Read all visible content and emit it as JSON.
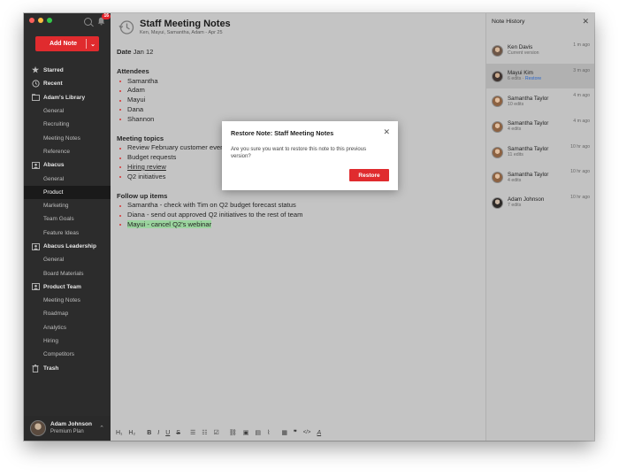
{
  "sidebar": {
    "notification_count": "16",
    "add_note_label": "Add Note",
    "items": [
      {
        "label": "Starred",
        "icon": "star-icon",
        "level": "top"
      },
      {
        "label": "Recent",
        "icon": "clock-icon",
        "level": "top"
      },
      {
        "label": "Adam's Library",
        "icon": "folder-icon",
        "level": "top"
      },
      {
        "label": "General",
        "level": "sub"
      },
      {
        "label": "Recruiting",
        "level": "sub"
      },
      {
        "label": "Meeting Notes",
        "level": "sub"
      },
      {
        "label": "Reference",
        "level": "sub"
      },
      {
        "label": "Abacus",
        "icon": "team-icon",
        "level": "top"
      },
      {
        "label": "General",
        "level": "sub"
      },
      {
        "label": "Product",
        "level": "sub",
        "active": true
      },
      {
        "label": "Marketing",
        "level": "sub"
      },
      {
        "label": "Team Goals",
        "level": "sub"
      },
      {
        "label": "Feature Ideas",
        "level": "sub"
      },
      {
        "label": "Abacus Leadership",
        "icon": "team-icon",
        "level": "top"
      },
      {
        "label": "General",
        "level": "sub"
      },
      {
        "label": "Board Materials",
        "level": "sub"
      },
      {
        "label": "Product Team",
        "icon": "team-icon",
        "level": "top"
      },
      {
        "label": "Meeting Notes",
        "level": "sub"
      },
      {
        "label": "Roadmap",
        "level": "sub"
      },
      {
        "label": "Analytics",
        "level": "sub"
      },
      {
        "label": "Hiring",
        "level": "sub"
      },
      {
        "label": "Competitors",
        "level": "sub"
      },
      {
        "label": "Trash",
        "icon": "trash-icon",
        "level": "top"
      }
    ],
    "user": {
      "name": "Adam Johnson",
      "plan": "Premium Plan"
    }
  },
  "note": {
    "title": "Staff Meeting Notes",
    "meta": "Ken, Mayui, Samantha, Adam - Apr 25",
    "date_label": "Date",
    "date_value": "Jan 12",
    "attendees_heading": "Attendees",
    "attendees": [
      "Samantha",
      "Adam",
      "Mayui",
      "Dana",
      "Shannon"
    ],
    "topics_heading": "Meeting topics",
    "topics": [
      "Review February customer events",
      "Budget requests",
      "Hiring review",
      "Q2 initiatives"
    ],
    "followup_heading": "Follow up items",
    "followups": [
      "Samantha - check with Tim on Q2 budget forecast status",
      "Diana - send out approved Q2 initiatives to the rest of team",
      "Mayui - cancel Q2's webinar"
    ]
  },
  "toolbar": {
    "buttons": [
      "H1",
      "H2",
      "B",
      "I",
      "U",
      "S",
      "bullet-list",
      "numbered-list",
      "checkbox",
      "link",
      "image",
      "film",
      "attach",
      "table",
      "quote",
      "code",
      "spellcheck"
    ],
    "h1": "H₁",
    "h2": "H₂",
    "bold": "B",
    "italic": "I",
    "underline": "U",
    "strike": "S",
    "quote": "❞",
    "code": "</>",
    "spell": "A"
  },
  "history": {
    "title": "Note History",
    "items": [
      {
        "name": "Ken Davis",
        "sub": "Current version",
        "time": "1 m ago",
        "avatar_color": "#8a6a55"
      },
      {
        "name": "Mayui Kim",
        "sub": "6 edits",
        "restore": "Restore",
        "time": "3 m ago",
        "avatar_color": "#6b5448",
        "selected": true
      },
      {
        "name": "Samantha Taylor",
        "sub": "10 edits",
        "time": "4 m ago",
        "avatar_color": "#a3784f"
      },
      {
        "name": "Samantha Taylor",
        "sub": "4 edits",
        "time": "4 m ago",
        "avatar_color": "#a3784f"
      },
      {
        "name": "Samantha Taylor",
        "sub": "11 edits",
        "time": "10 hr ago",
        "avatar_color": "#a3784f"
      },
      {
        "name": "Samantha Taylor",
        "sub": "4 edits",
        "time": "10 hr ago",
        "avatar_color": "#a3784f"
      },
      {
        "name": "Adam Johnson",
        "sub": "7 edits",
        "time": "10 hr ago",
        "avatar_color": "#4a3f38"
      }
    ]
  },
  "modal": {
    "title": "Restore Note: Staff Meeting Notes",
    "text": "Are you sure you want to restore this note to this previous version?",
    "button": "Restore"
  },
  "colors": {
    "accent": "#e02b2e",
    "sidebar": "#2c2c2c",
    "highlight": "#9bd49e",
    "link": "#2a66c9"
  }
}
